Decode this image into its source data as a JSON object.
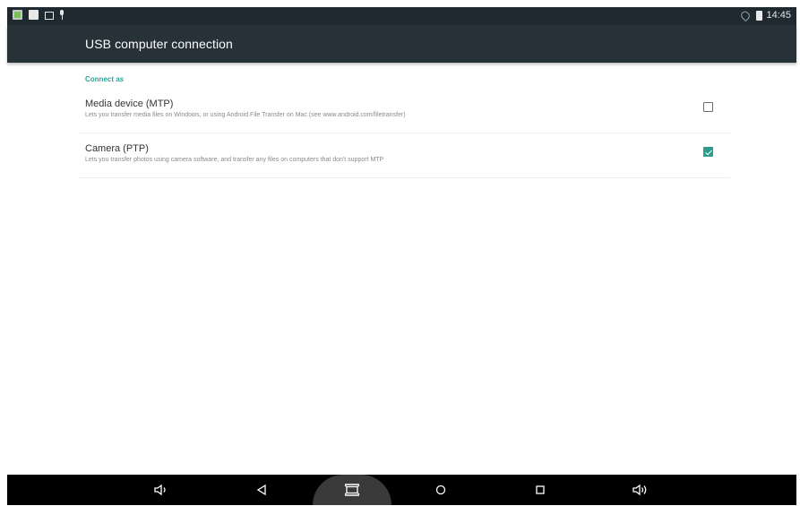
{
  "status_bar": {
    "time": "14:45",
    "left_icons": [
      "gallery-icon",
      "notification-icon",
      "screenshot-icon",
      "usb-icon"
    ],
    "right_icons": [
      "wifi-icon",
      "battery-icon"
    ]
  },
  "app_bar": {
    "title": "USB computer connection"
  },
  "settings": {
    "section_header": "Connect as",
    "options": [
      {
        "title": "Media device (MTP)",
        "summary": "Lets you transfer media files on Windows, or using Android File Transfer on Mac (see www.android.com/filetransfer)",
        "checked": false
      },
      {
        "title": "Camera (PTP)",
        "summary": "Lets you transfer photos using camera software, and transfer any files on computers that don't support MTP",
        "checked": true
      }
    ]
  },
  "nav_bar": {
    "buttons": [
      "volume-down-icon",
      "back-icon",
      "screenshot-icon",
      "home-icon",
      "recents-icon",
      "volume-up-icon"
    ]
  },
  "colors": {
    "status_bar": "#1f2a30",
    "app_bar": "#263238",
    "accent": "#2a9d8f",
    "nav_bar": "#000000"
  }
}
